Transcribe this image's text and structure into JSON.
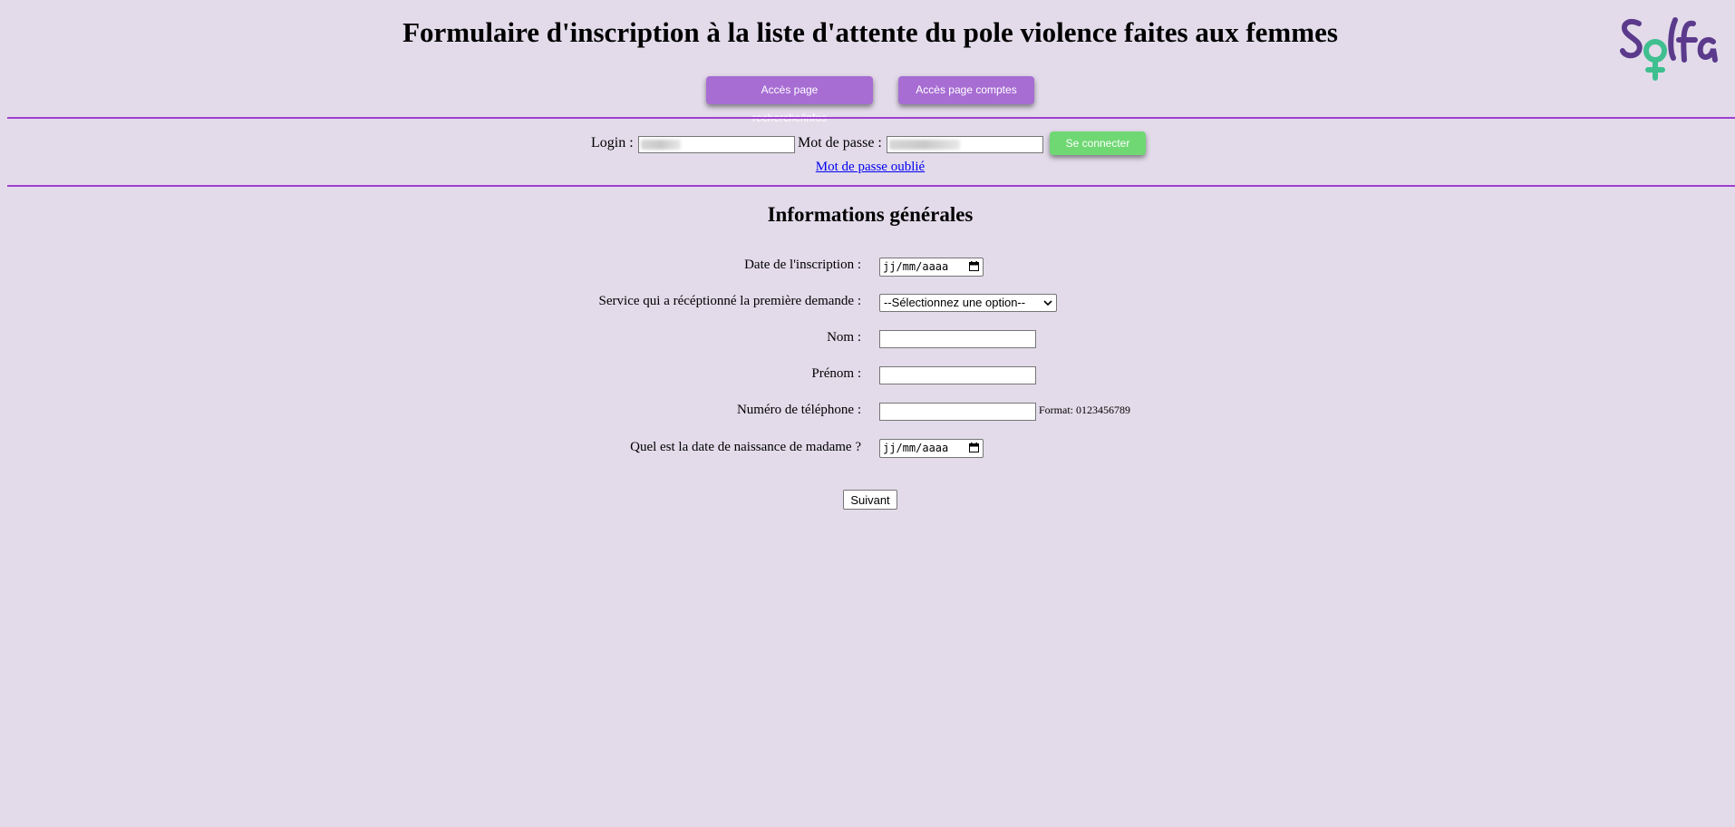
{
  "header": {
    "title": "Formulaire d'inscription à la liste d'attente du pole violence faites aux femmes",
    "logo_text": "Solfa",
    "colors": {
      "logo_purple": "#5b3a8c",
      "logo_green": "#3fbf8f"
    }
  },
  "nav": {
    "search_button": "Accès page recherche/infos",
    "accounts_button": "Accès page comptes",
    "button_color": "#a76dd3"
  },
  "login": {
    "login_label": "Login :",
    "password_label": "Mot de passe :",
    "connect_button": "Se connecter",
    "connect_color": "#6fd873",
    "forgot_link": "Mot de passe oublié"
  },
  "section": {
    "title": "Informations générales"
  },
  "form": {
    "date_label": "Date de l'inscription :",
    "date_value": "jj/mm/aaaa",
    "service_label": "Service qui a récéptionné la première demande :",
    "service_selected": "--Sélectionnez une option--",
    "nom_label": "Nom :",
    "prenom_label": "Prénom :",
    "phone_label": "Numéro de téléphone :",
    "phone_hint": "Format: 0123456789",
    "birth_label": "Quel est la date de naissance de madame ?",
    "birth_value": "jj/mm/aaaa",
    "next_button": "Suivant"
  },
  "theme": {
    "background": "#e3dbea",
    "divider": "#9f3fcf"
  }
}
